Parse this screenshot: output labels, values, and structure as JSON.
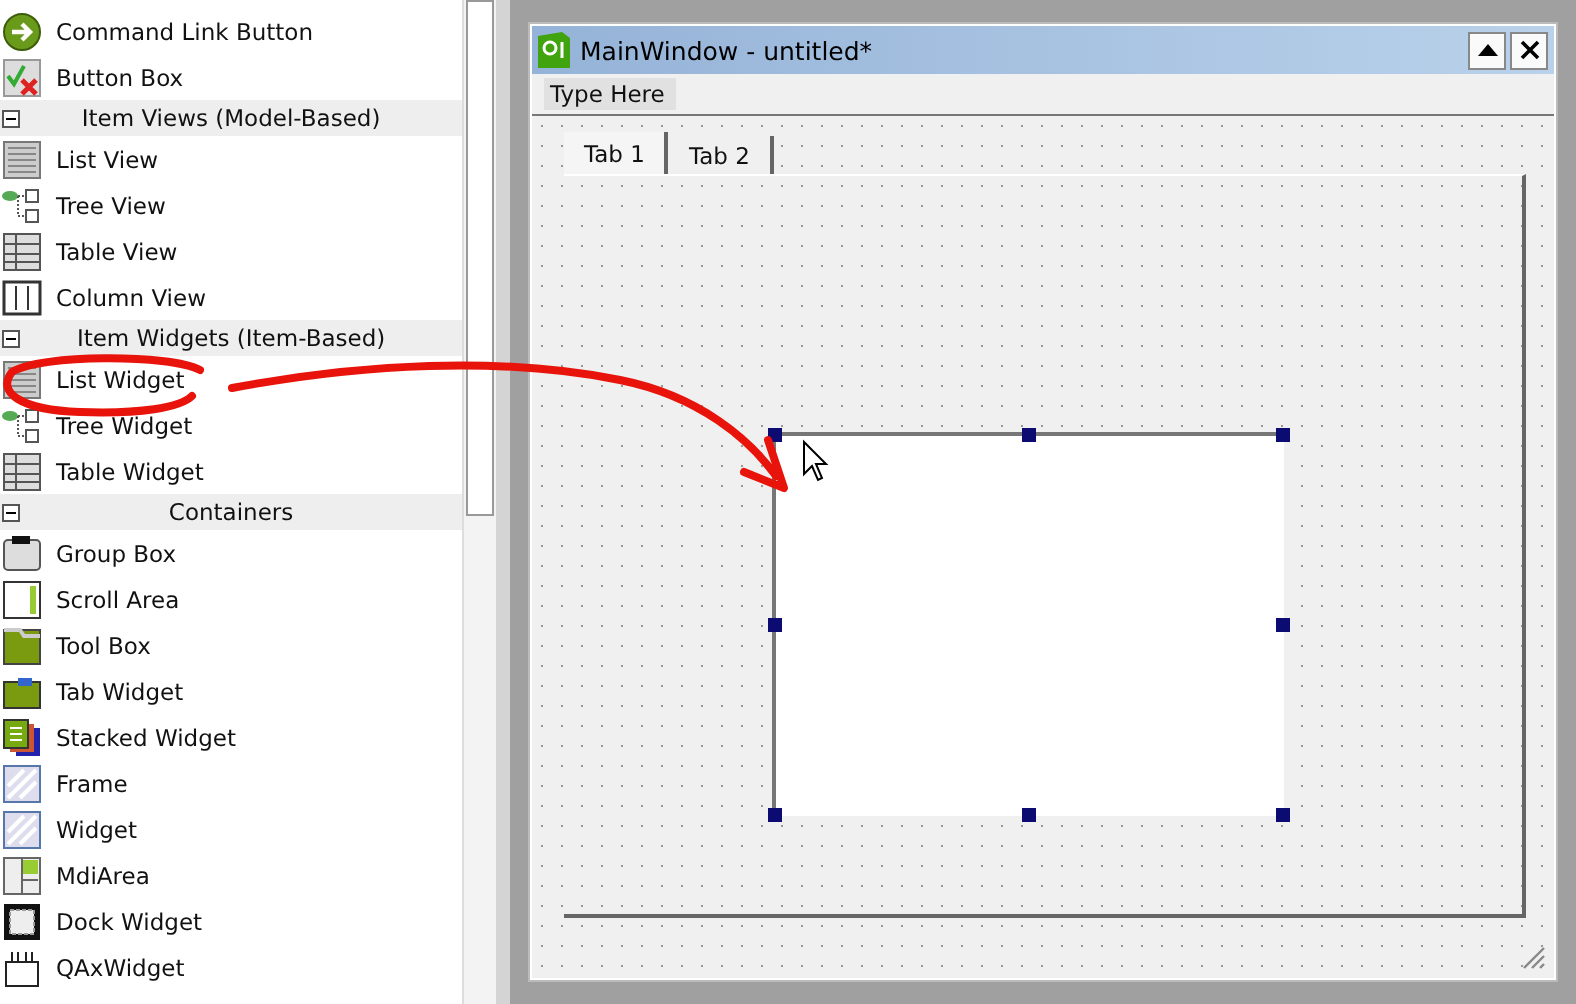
{
  "widget_box": {
    "entries": [
      {
        "kind": "item",
        "label": "Command Link Button"
      },
      {
        "kind": "item",
        "label": "Button Box"
      },
      {
        "kind": "category",
        "label": "Item Views (Model-Based)",
        "expanded": true
      },
      {
        "kind": "item",
        "label": "List View"
      },
      {
        "kind": "item",
        "label": "Tree View"
      },
      {
        "kind": "item",
        "label": "Table View"
      },
      {
        "kind": "item",
        "label": "Column View"
      },
      {
        "kind": "category",
        "label": "Item Widgets (Item-Based)",
        "expanded": true
      },
      {
        "kind": "item",
        "label": "List Widget"
      },
      {
        "kind": "item",
        "label": "Tree Widget"
      },
      {
        "kind": "item",
        "label": "Table Widget"
      },
      {
        "kind": "category",
        "label": "Containers",
        "expanded": true
      },
      {
        "kind": "item",
        "label": "Group Box"
      },
      {
        "kind": "item",
        "label": "Scroll Area"
      },
      {
        "kind": "item",
        "label": "Tool Box"
      },
      {
        "kind": "item",
        "label": "Tab Widget"
      },
      {
        "kind": "item",
        "label": "Stacked Widget"
      },
      {
        "kind": "item",
        "label": "Frame"
      },
      {
        "kind": "item",
        "label": "Widget"
      },
      {
        "kind": "item",
        "label": "MdiArea"
      },
      {
        "kind": "item",
        "label": "Dock Widget"
      },
      {
        "kind": "item",
        "label": "QAxWidget"
      }
    ]
  },
  "form_window": {
    "title": "MainWindow - untitled*",
    "menu_bar": {
      "placeholder": "Type Here"
    },
    "tabs": [
      {
        "label": "Tab 1",
        "selected": true
      },
      {
        "label": "Tab 2",
        "selected": false
      }
    ],
    "list_widget": {
      "selected": true
    }
  }
}
